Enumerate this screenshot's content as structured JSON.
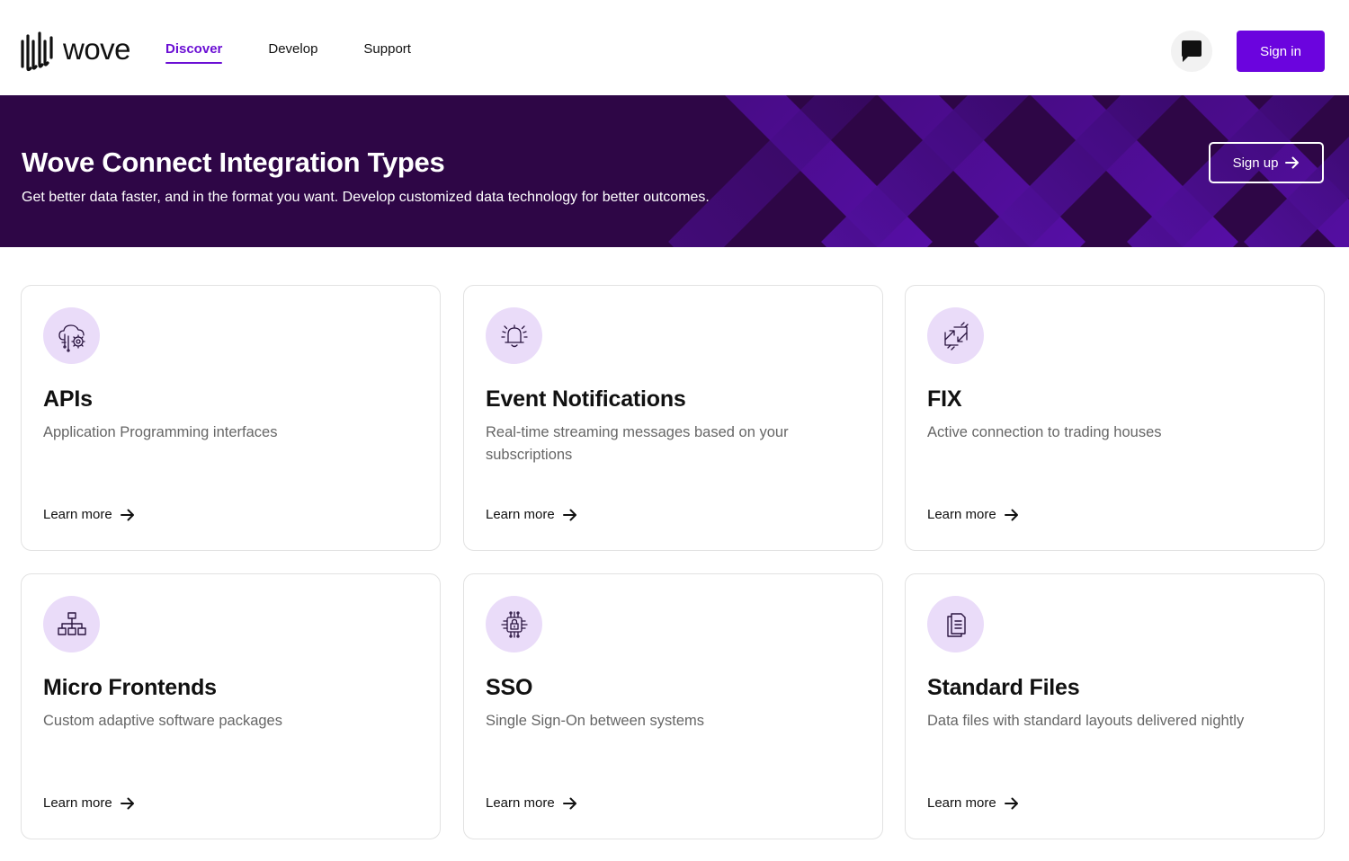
{
  "header": {
    "logo_text": "wove",
    "nav": [
      "Discover",
      "Develop",
      "Support"
    ],
    "active_nav": "Discover",
    "chat_icon": "chat-bubble-icon",
    "signin_label": "Sign in"
  },
  "hero": {
    "title": "Wove Connect Integration Types",
    "subtitle": "Get better data faster, and in the format you want. Develop customized data technology for better outcomes.",
    "signup_label": "Sign up"
  },
  "cards": [
    {
      "icon": "cloud-gear-icon",
      "title": "APIs",
      "description": "Application Programming interfaces",
      "link": "Learn more"
    },
    {
      "icon": "bell-icon",
      "title": "Event Notifications",
      "description": "Real-time streaming messages based on your subscriptions",
      "link": "Learn more"
    },
    {
      "icon": "exchange-arrows-icon",
      "title": "FIX",
      "description": "Active connection to trading houses",
      "link": "Learn more"
    },
    {
      "icon": "sitemap-icon",
      "title": "Micro Frontends",
      "description": "Custom adaptive software packages",
      "link": "Learn more"
    },
    {
      "icon": "lock-chip-icon",
      "title": "SSO",
      "description": "Single Sign-On between systems",
      "link": "Learn more"
    },
    {
      "icon": "documents-icon",
      "title": "Standard Files",
      "description": "Data files with standard layouts delivered nightly",
      "link": "Learn more"
    }
  ],
  "colors": {
    "brand_purple": "#6b04de",
    "hero_background": "#2e0646",
    "icon_circle": "#eadcf9"
  }
}
